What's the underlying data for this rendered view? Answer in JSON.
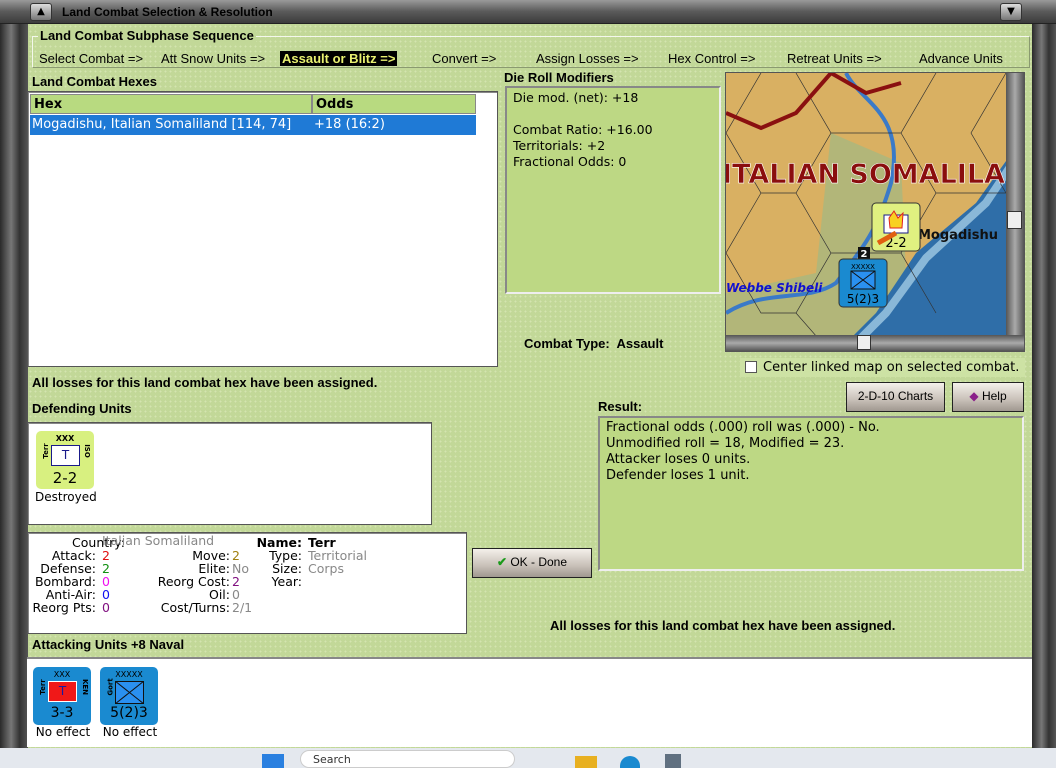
{
  "window": {
    "title": "Land Combat Selection & Resolution"
  },
  "subphase": {
    "title": "Land Combat Subphase Sequence",
    "steps": [
      "Select Combat =>",
      "Att Snow Units =>",
      "Assault or Blitz =>",
      "Convert =>",
      "Assign Losses =>",
      "Hex Control =>",
      "Retreat Units =>",
      "Advance Units"
    ],
    "active_index": 2
  },
  "hexes": {
    "title": "Land Combat Hexes",
    "columns": [
      "Hex",
      "Odds"
    ],
    "rows": [
      {
        "hex": "Mogadishu, Italian Somaliland [114, 74]",
        "odds": "+18 (16:2)"
      }
    ]
  },
  "die_roll": {
    "title": "Die Roll Modifiers",
    "lines": [
      "Die mod. (net): +18",
      "",
      "Combat Ratio: +16.00",
      "Territorials: +2",
      "Fractional Odds: 0"
    ]
  },
  "combat_type": {
    "label": "Combat Type:",
    "value": "Assault"
  },
  "map": {
    "region_label": "ITALIAN SOMALILA",
    "city": "Mogadishu",
    "river": "Webbe Shibeli",
    "stack_count": "2",
    "defender_strength": "2-2",
    "attacker_strength": "5(2)3",
    "attacker_size": "XXXXX",
    "defender_size": "XXX"
  },
  "center_map": {
    "label": "Center linked map on selected combat.",
    "checked": false
  },
  "buttons": {
    "charts": "2-D-10 Charts",
    "help": "Help",
    "ok": "OK - Done"
  },
  "status_top": "All losses for this land combat hex have been assigned.",
  "status_bottom": "All losses for this land combat hex have been assigned.",
  "defending": {
    "title": "Defending Units",
    "units": [
      {
        "size": "XXX",
        "left": "Terr",
        "right": "ISO",
        "symbol": "T",
        "strength": "2-2",
        "status": "Destroyed"
      }
    ]
  },
  "unit_info": {
    "country_label": "Country:",
    "country": "Italian Somaliland",
    "attack_label": "Attack:",
    "attack": "2",
    "defense_label": "Defense:",
    "defense": "2",
    "bombard_label": "Bombard:",
    "bombard": "0",
    "antiair_label": "Anti-Air:",
    "antiair": "0",
    "reorgpts_label": "Reorg Pts:",
    "reorgpts": "0",
    "move_label": "Move:",
    "move": "2",
    "elite_label": "Elite:",
    "elite": "No",
    "reorgcost_label": "Reorg Cost:",
    "reorgcost": "2",
    "oil_label": "Oil:",
    "oil": "0",
    "costturns_label": "Cost/Turns:",
    "costturns": "2/1",
    "name_label": "Name:",
    "name": "Terr",
    "type_label": "Type:",
    "type": "Territorial",
    "size_label": "Size:",
    "size": "Corps",
    "year_label": "Year:",
    "year": ""
  },
  "result": {
    "title": "Result:",
    "lines": [
      "Fractional odds (.000) roll was (.000)  - No.",
      "Unmodified roll = 18, Modified = 23.",
      "Attacker loses 0 units.",
      "Defender loses 1 unit."
    ]
  },
  "attacking": {
    "title": "Attacking Units +8 Naval",
    "units": [
      {
        "size": "XXX",
        "left": "Terr",
        "right": "KEN",
        "symbol": "T",
        "strength": "3-3",
        "status": "No effect"
      },
      {
        "size": "XXXXX",
        "left": "Gort",
        "right": "",
        "symbol": "",
        "strength": "5(2)3",
        "status": "No effect"
      }
    ]
  },
  "taskbar": {
    "search": "Search"
  }
}
